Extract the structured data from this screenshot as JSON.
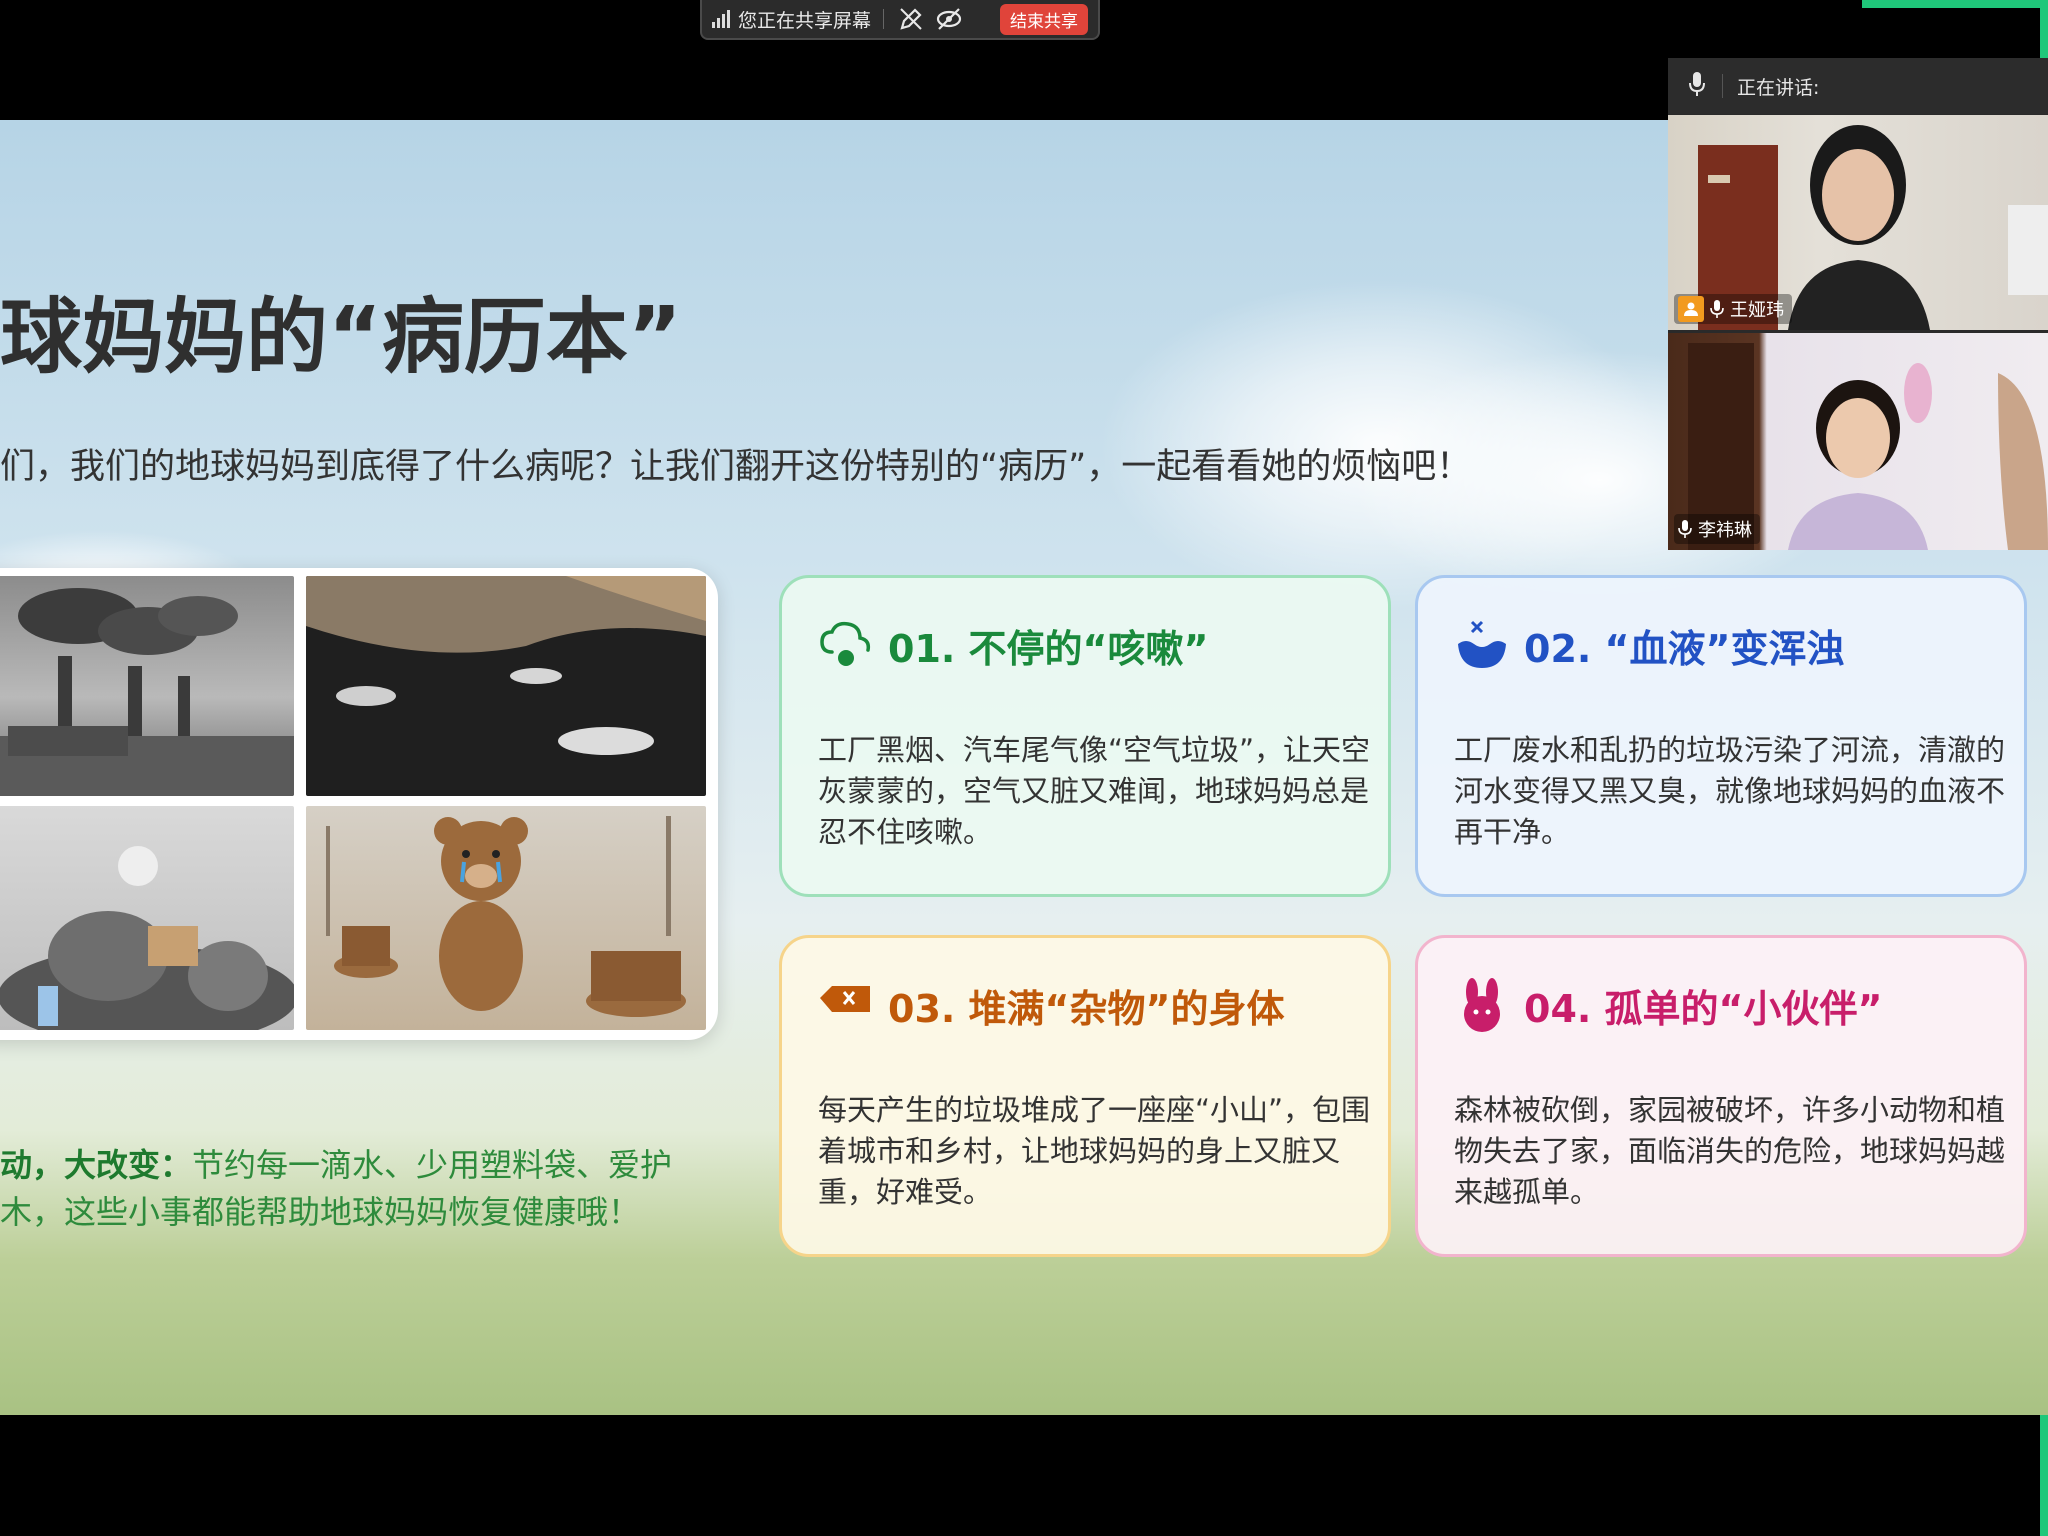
{
  "share_bar": {
    "status_text": "您正在共享屏幕",
    "end_button": "结束共享"
  },
  "slide": {
    "title": "球妈妈的“病历本”",
    "subtitle": "们，我们的地球妈妈到底得了什么病呢？让我们翻开这份特别的“病历”，一起看看她的烦恼吧！",
    "tip_bold": "动，大改变：",
    "tip_line1": "节约每一滴水、少用塑料袋、爱护",
    "tip_line2": "木，这些小事都能帮助地球妈妈恢复健康哦！",
    "cards": [
      {
        "title": "01. 不停的“咳嗽”",
        "body": "工厂黑烟、汽车尾气像“空气垃圾”，让天空灰蒙蒙的，空气又脏又难闻，地球妈妈总是忍不住咳嗽。",
        "icon": "cloud-cough-icon"
      },
      {
        "title": "02. “血液”变浑浊",
        "body": "工厂废水和乱扔的垃圾污染了河流，清澈的河水变得又黑又臭，就像地球妈妈的血液不再干净。",
        "icon": "polluted-water-icon"
      },
      {
        "title": "03. 堆满“杂物”的身体",
        "body": "每天产生的垃圾堆成了一座座“小山”，包围着城市和乡村，让地球妈妈的身上又脏又重，好难受。",
        "icon": "trash-tag-icon"
      },
      {
        "title": "04. 孤单的“小伙伴”",
        "body": "森林被砍倒，家园被破坏，许多小动物和植物失去了家，面临消失的危险，地球妈妈越来越孤单。",
        "icon": "bunny-icon"
      }
    ],
    "accent_colors": {
      "card1": "#1a8a3c",
      "card2": "#2252c4",
      "card3": "#c0590a",
      "card4": "#c81e6a"
    }
  },
  "video_panel": {
    "speaking_label": "正在讲话:",
    "participants": [
      {
        "name": "王娅玮"
      },
      {
        "name": "李祎琳"
      }
    ]
  }
}
